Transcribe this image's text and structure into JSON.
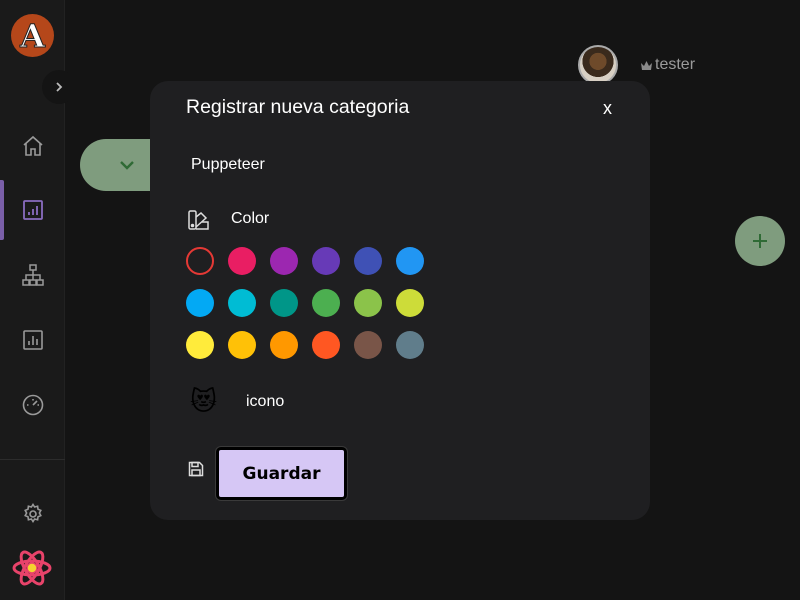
{
  "sidebar": {
    "logo_letter": "A",
    "items": [
      {
        "icon": "home-icon"
      },
      {
        "icon": "chart-icon",
        "active": true
      },
      {
        "icon": "sitemap-icon"
      },
      {
        "icon": "report-icon"
      },
      {
        "icon": "dashboard-gauge-icon"
      }
    ],
    "settings_icon": "gear-icon"
  },
  "header": {
    "username": "tester",
    "username_prefix_icon": "crown-icon"
  },
  "modal": {
    "title": "Registrar nueva categoria",
    "close_label": "x",
    "name_value": "Puppeteer",
    "color_label": "Color",
    "colors": [
      "#f44336",
      "#e91e63",
      "#9c27b0",
      "#673ab7",
      "#3f51b5",
      "#2196f3",
      "#03a9f4",
      "#00bcd4",
      "#009688",
      "#4caf50",
      "#8bc34a",
      "#cddc39",
      "#ffeb3b",
      "#ffc107",
      "#ff9800",
      "#ff5722",
      "#795548",
      "#607d8b"
    ],
    "selected_color_index": 0,
    "icon_label": "icono",
    "icon_emoji": "😻",
    "save_label": "Guardar"
  },
  "accent": "#d6c7f5"
}
